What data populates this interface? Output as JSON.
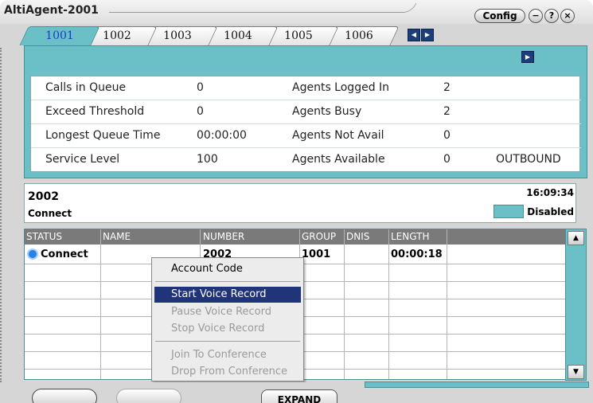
{
  "window": {
    "title": "AltiAgent-2001",
    "config_label": "Config"
  },
  "title_buttons": [
    {
      "name": "minimize",
      "glyph": "−"
    },
    {
      "name": "help",
      "glyph": "?"
    },
    {
      "name": "close",
      "glyph": "×"
    }
  ],
  "tabs": [
    "1001",
    "1002",
    "1003",
    "1004",
    "1005",
    "1006"
  ],
  "active_tab": "1001",
  "stats": {
    "rows": [
      {
        "label1": "Calls in Queue",
        "value1": "0",
        "label2": "Agents Logged In",
        "value2": "2",
        "extra": ""
      },
      {
        "label1": "Exceed Threshold",
        "value1": "0",
        "label2": "Agents Busy",
        "value2": "2",
        "extra": ""
      },
      {
        "label1": "Longest Queue Time",
        "value1": "00:00:00",
        "label2": "Agents Not Avail",
        "value2": "0",
        "extra": ""
      },
      {
        "label1": "Service Level",
        "value1": "100",
        "label2": "Agents Available",
        "value2": "0",
        "extra": "OUTBOUND"
      }
    ]
  },
  "call_info": {
    "number": "2002",
    "state": "Connect",
    "time": "16:09:34",
    "status": "Disabled"
  },
  "grid": {
    "headers": [
      "STATUS",
      "NAME",
      "NUMBER",
      "GROUP",
      "DNIS",
      "LENGTH"
    ],
    "row": {
      "status": "Connect",
      "name": "",
      "number": "2002",
      "group": "1001",
      "dnis": "",
      "length": "00:00:18"
    }
  },
  "context_menu": {
    "items": [
      {
        "label": "Account Code",
        "state": "normal"
      },
      {
        "label": "Start Voice Record",
        "state": "selected"
      },
      {
        "label": "Pause Voice Record",
        "state": "disabled"
      },
      {
        "label": "Stop Voice Record",
        "state": "disabled"
      },
      {
        "label": "Join To Conference",
        "state": "disabled"
      },
      {
        "label": "Drop From Conference",
        "state": "disabled"
      }
    ]
  },
  "footer": {
    "expand_label": "EXPAND"
  },
  "colors": {
    "teal": "#6bbfc6",
    "tab_active_text": "#1a3ad0",
    "menu_selected": "#20347a"
  }
}
